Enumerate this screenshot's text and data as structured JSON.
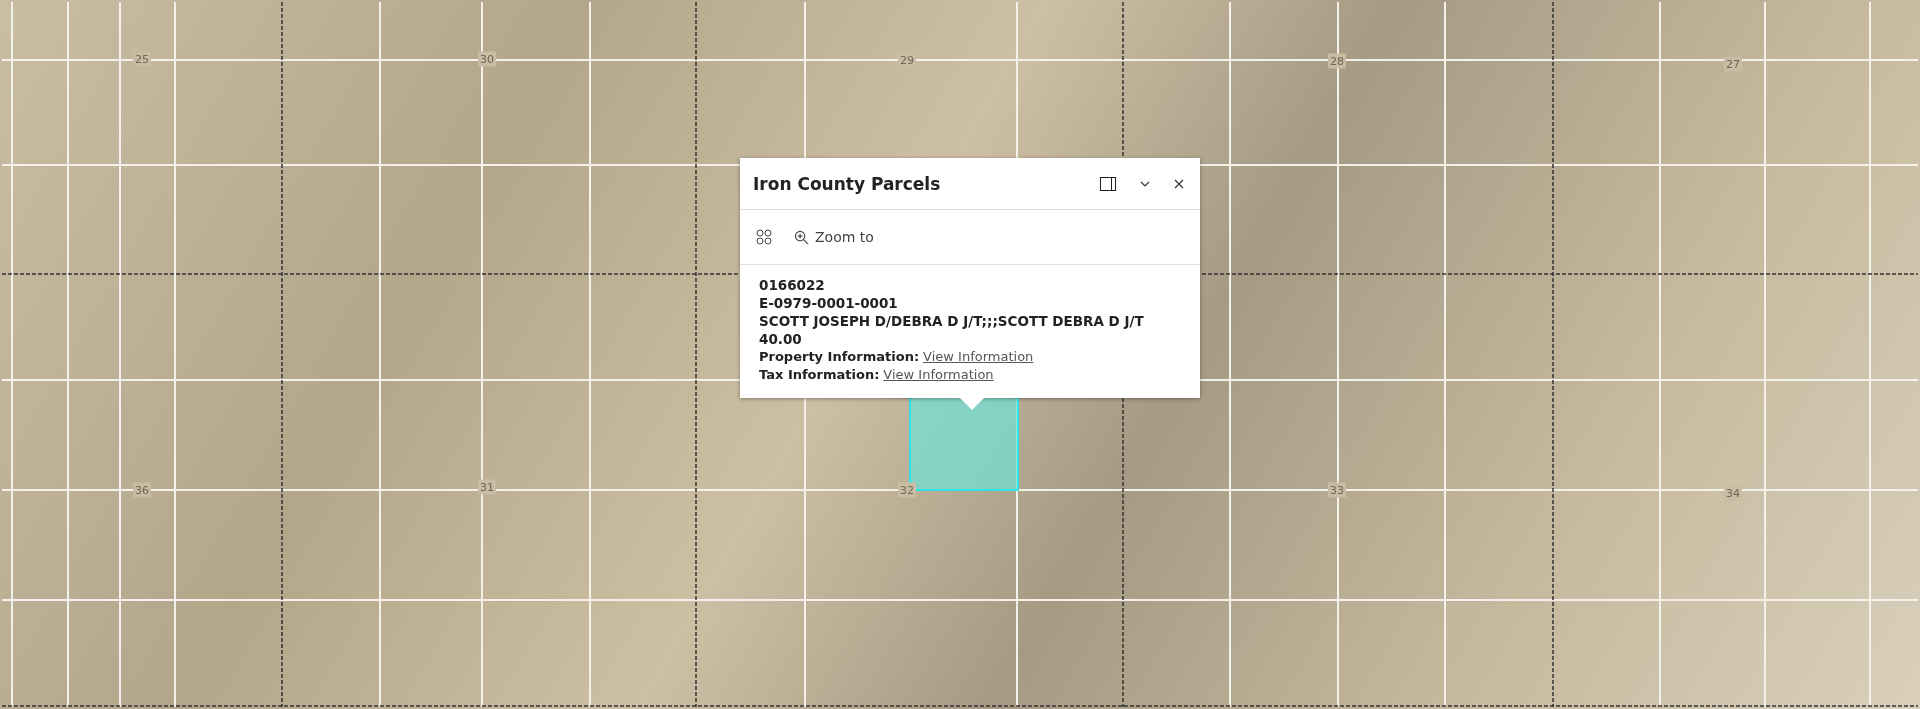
{
  "map": {
    "section_labels": [
      "25",
      "30",
      "29",
      "28",
      "27",
      "36",
      "31",
      "32",
      "33",
      "34"
    ],
    "selected_parcel": true
  },
  "popup": {
    "title": "Iron County Parcels",
    "actions": [
      {
        "kind": "dock"
      },
      {
        "kind": "collapse"
      },
      {
        "kind": "close"
      }
    ],
    "toolbar": [
      {
        "kind": "menu"
      },
      {
        "kind": "zoom",
        "label": "Zoom to"
      }
    ],
    "lines": [
      "0166022",
      "E-0979-0001-0001",
      "SCOTT JOSEPH D/DEBRA D J/T;;;SCOTT DEBRA D J/T",
      "40.00"
    ],
    "links": [
      {
        "label": "Property Information:",
        "link": "View Information"
      },
      {
        "label": "Tax Information:",
        "link": "View Information"
      }
    ]
  }
}
